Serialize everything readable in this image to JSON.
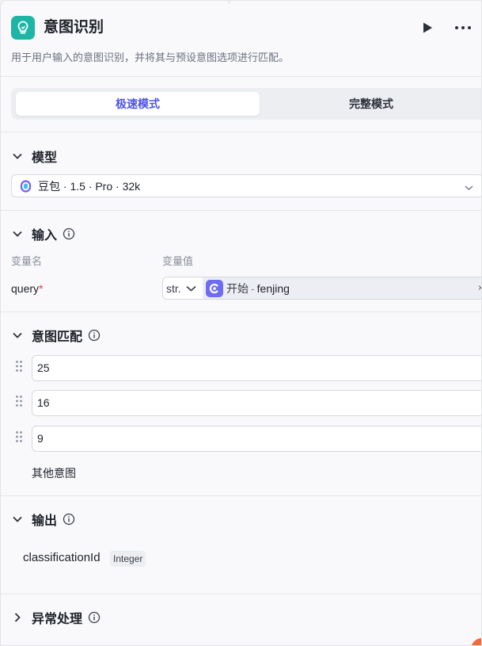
{
  "header": {
    "title": "意图识别",
    "description": "用于用户输入的意图识别，并将其与预设意图选项进行匹配。",
    "icon": "lightbulb-icon",
    "run_icon": "play-icon",
    "more_icon": "more-horizontal-icon"
  },
  "mode": {
    "tabs": [
      "极速模式",
      "完整模式"
    ],
    "active": "极速模式"
  },
  "model": {
    "section_title": "模型",
    "selected": "豆包 · 1.5 · Pro · 32k"
  },
  "input": {
    "section_title": "输入",
    "col_name": "变量名",
    "col_value": "变量值",
    "var_name": "query",
    "required_mark": "*",
    "type": "str.",
    "ref_node": "开始",
    "ref_sep": "-",
    "ref_var": "fenjing",
    "clear_glyph": "×"
  },
  "intents": {
    "section_title": "意图匹配",
    "items": [
      "25",
      "16",
      "9"
    ],
    "other_label": "其他意图"
  },
  "output": {
    "section_title": "输出",
    "var_name": "classificationId",
    "var_type": "Integer"
  },
  "error_handling": {
    "section_title": "异常处理"
  },
  "colors": {
    "accent": "#4d53e8",
    "brand": "#1eb5a6",
    "ref_node": "#6e6cf1"
  }
}
